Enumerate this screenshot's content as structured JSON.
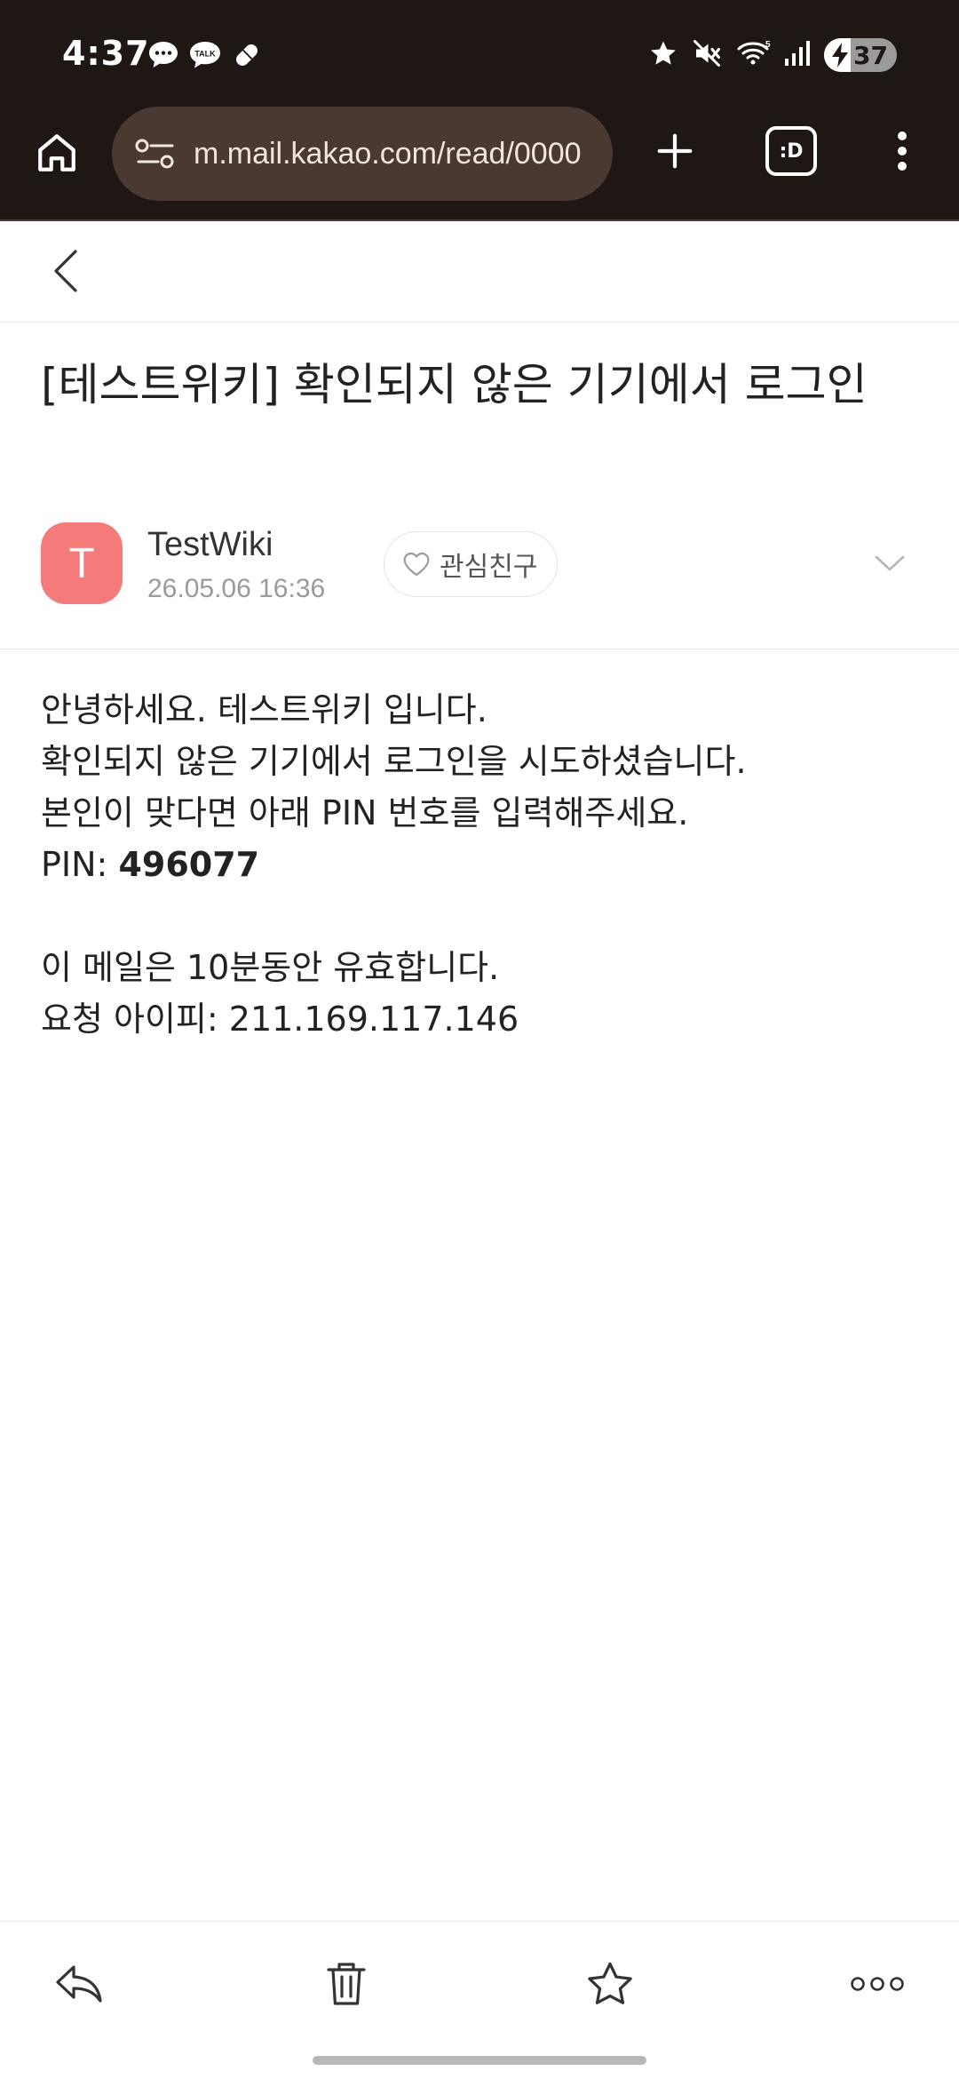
{
  "status_bar": {
    "time": "4:37",
    "battery_percent": "37",
    "battery_level": 0.37,
    "left_icons": [
      "message-bubble-icon",
      "kakaotalk-icon",
      "pill-icon"
    ],
    "right_icons": [
      "star-icon",
      "mute-icon",
      "wifi-icon",
      "signal-icon",
      "battery-charging-icon"
    ]
  },
  "browser": {
    "url": "m.mail.kakao.com/read/0000",
    "tabs_label": ":D"
  },
  "mail": {
    "subject": "[테스트위키] 확인되지 않은 기기에서 로그인",
    "sender": {
      "initial": "T",
      "name": "TestWiki",
      "date": "26.05.06 16:36",
      "avatar_color": "#f57b7b"
    },
    "favorite_label": "관심친구",
    "body": {
      "line1": "안녕하세요. 테스트위키 입니다.",
      "line2": "확인되지 않은 기기에서 로그인을 시도하셨습니다.",
      "line3": "본인이 맞다면 아래 PIN 번호를 입력해주세요.",
      "pin_label": "PIN: ",
      "pin_value": "496077",
      "line5": "이 메일은 10분동안 유효합니다.",
      "line6": "요청 아이피: 211.169.117.146"
    }
  },
  "actions": [
    "reply-icon",
    "trash-icon",
    "star-icon",
    "more-icon"
  ],
  "colors": {
    "chrome_bg": "#1f1714",
    "url_bar_bg": "#4a3930",
    "accent_avatar": "#f57b7b"
  }
}
